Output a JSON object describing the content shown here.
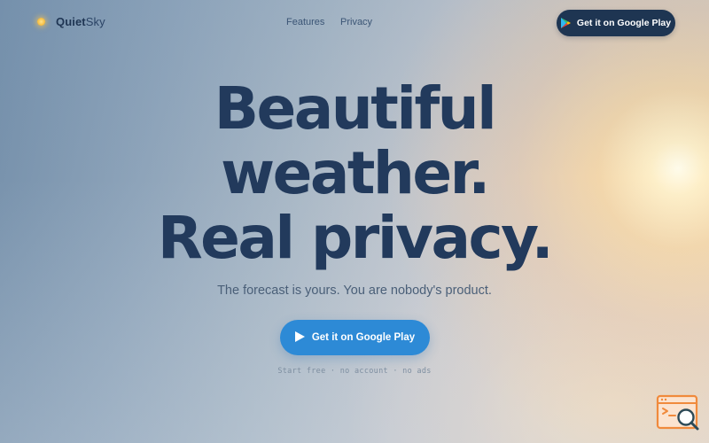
{
  "nav": {
    "logo": {
      "strong": "Quiet",
      "light": "Sky",
      "icon": "sun-dot-icon"
    },
    "links": [
      {
        "label": "Features"
      },
      {
        "label": "Privacy"
      }
    ],
    "cta_label": "Get it on Google Play",
    "cta_color": "#1e3552"
  },
  "hero": {
    "title_lines": [
      "Beautiful",
      "weather.",
      "Real privacy."
    ],
    "subtitle": "The forecast is yours. You are nobody's product.",
    "cta_label": "Get it on Google Play",
    "cta_color": "#2d8ad6",
    "note": "Start free · no account · no ads"
  },
  "colors": {
    "title": "#223a5c",
    "accent_sun": "#f5b93a",
    "badge": "#f08a3c"
  },
  "floating_badge": {
    "icon": "browser-search-icon"
  }
}
